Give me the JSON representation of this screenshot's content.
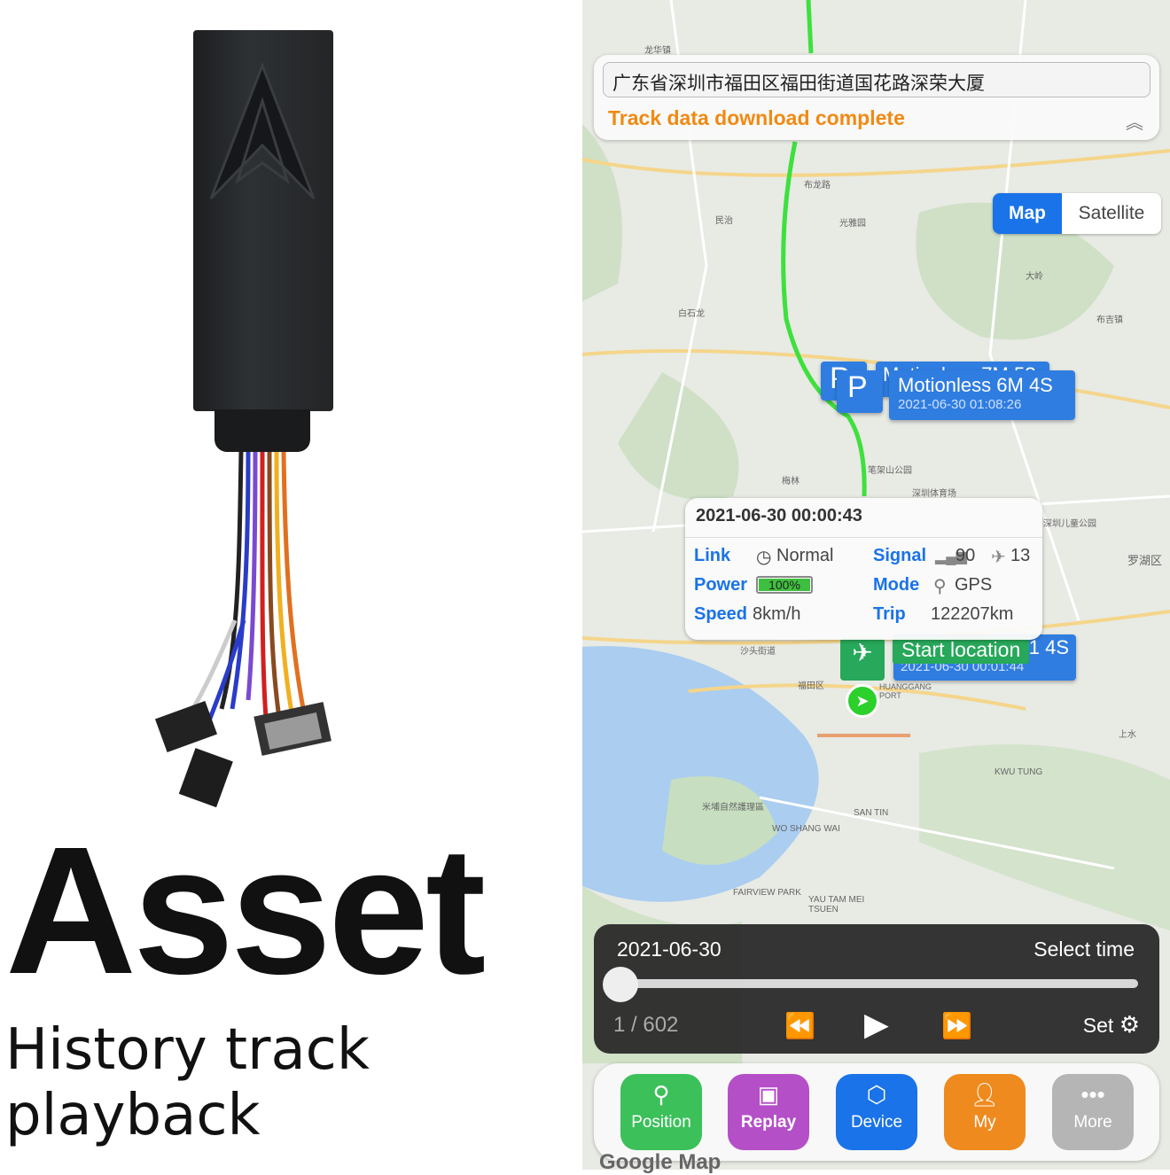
{
  "hero": {
    "title": "Asset",
    "subtitle": "History track playback"
  },
  "app": {
    "address": "广东省深圳市福田区福田街道国花路深荣大厦",
    "status": "Track data download complete",
    "map_toggle": {
      "map": "Map",
      "satellite": "Satellite",
      "selected": "Map"
    },
    "markers": {
      "stop": {
        "icon": "P",
        "title": "Motionless 6M 4S",
        "time": "2021-06-30 01:08:26",
        "hidden_title": "Motionless 7M 5?"
      },
      "start": {
        "title": "Start location",
        "time": "2021-06-30 00:01:44",
        "suffix": "1 4S"
      }
    },
    "popup": {
      "timestamp": "2021-06-30 00:00:43",
      "link_label": "Link",
      "link_value": "Normal",
      "signal_label": "Signal",
      "signal_value": "90",
      "satellites": "13",
      "power_label": "Power",
      "power_value": "100%",
      "mode_label": "Mode",
      "mode_value": "GPS",
      "speed_label": "Speed",
      "speed_value": "8km/h",
      "trip_label": "Trip",
      "trip_value": "122207km"
    },
    "player": {
      "date": "2021-06-30",
      "select_time": "Select time",
      "counter": "1 / 602",
      "progress": 0,
      "set_label": "Set"
    },
    "tabs": [
      {
        "label": "Position",
        "icon": "location-pin-icon",
        "color": "#3cc05a"
      },
      {
        "label": "Replay",
        "icon": "video-icon",
        "color": "#b44fc8"
      },
      {
        "label": "Device",
        "icon": "cube-icon",
        "color": "#1a73e8"
      },
      {
        "label": "My",
        "icon": "person-icon",
        "color": "#ef8a1e"
      },
      {
        "label": "More",
        "icon": "more-icon",
        "color": "#b5b5b5"
      }
    ],
    "map_credit": "Google Map",
    "map_labels": [
      "龙华镇",
      "布龙路",
      "民治",
      "光雅园",
      "白石龙",
      "大岭",
      "布吉镇",
      "梅林",
      "笔架山公园",
      "深圳体育场",
      "深圳儿童公园",
      "罗湖区",
      "福田区",
      "沙头街道",
      "HUANGGANG PORT",
      "上水",
      "KWU TUNG",
      "SAN TIN",
      "WO SHANG WAI",
      "FAIRVIEW PARK",
      "YAU TAM MEI TSUEN",
      "米埔自然護理區"
    ]
  }
}
